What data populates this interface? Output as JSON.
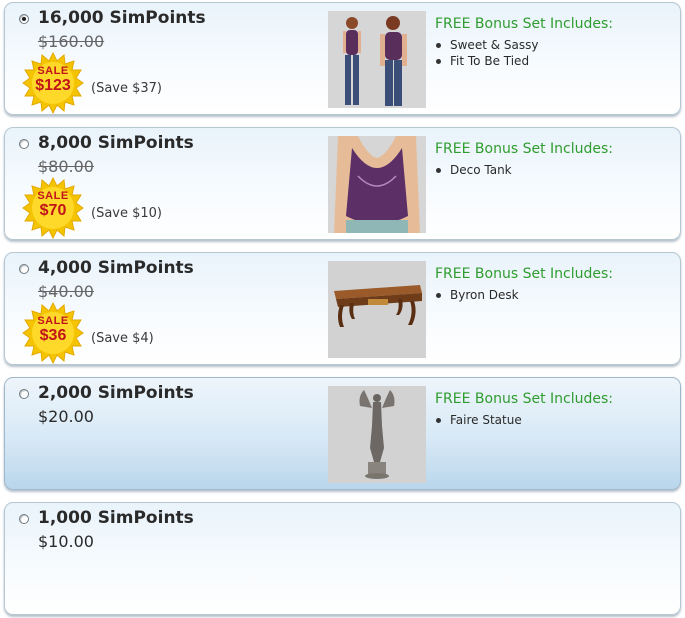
{
  "options": [
    {
      "title": "16,000 SimPoints",
      "old_price": "$160.00",
      "sale_word": "SALE",
      "sale_price": "$123",
      "save": "(Save $37)",
      "bonus_title": "FREE Bonus Set Includes:",
      "bonus_items": [
        "Sweet & Sassy",
        "Fit To Be Tied"
      ],
      "selected": true
    },
    {
      "title": "8,000 SimPoints",
      "old_price": "$80.00",
      "sale_word": "SALE",
      "sale_price": "$70",
      "save": "(Save $10)",
      "bonus_title": "FREE Bonus Set Includes:",
      "bonus_items": [
        "Deco Tank"
      ]
    },
    {
      "title": "4,000 SimPoints",
      "old_price": "$40.00",
      "sale_word": "SALE",
      "sale_price": "$36",
      "save": "(Save $4)",
      "bonus_title": "FREE Bonus Set Includes:",
      "bonus_items": [
        "Byron Desk"
      ]
    },
    {
      "title": "2,000 SimPoints",
      "price": "$20.00",
      "bonus_title": "FREE Bonus Set Includes:",
      "bonus_items": [
        "Faire Statue"
      ],
      "highlighted": true
    },
    {
      "title": "1,000 SimPoints",
      "price": "$10.00"
    }
  ],
  "colors": {
    "bonus_green": "#2e9c2e",
    "sale_red": "#c0141a",
    "badge_yellow": "#f5c400"
  },
  "icons": {
    "sale_badge": "starburst-badge-icon",
    "radio": "radio-button-icon"
  }
}
